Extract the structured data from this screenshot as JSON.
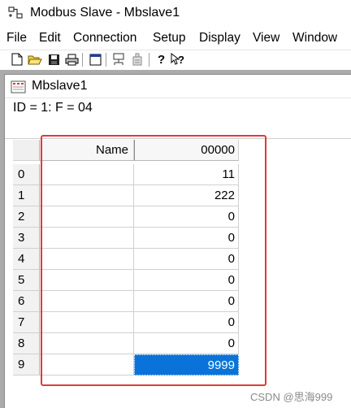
{
  "window": {
    "title": "Modbus Slave - Mbslave1",
    "app_icon": "modbus-app-icon"
  },
  "menu": [
    {
      "label": "File"
    },
    {
      "label": "Edit"
    },
    {
      "label": "Connection"
    },
    {
      "label": "Setup"
    },
    {
      "label": "Display"
    },
    {
      "label": "View"
    },
    {
      "label": "Window"
    }
  ],
  "toolbar": [
    "new-icon",
    "open-icon",
    "save-icon",
    "print-icon",
    "window-icon",
    "connect-icon",
    "disconnect-icon",
    "help-icon",
    "context-help-icon"
  ],
  "child_window": {
    "title": "Mbslave1",
    "id_line": "ID = 1: F = 04",
    "grid": {
      "header": {
        "name": "Name",
        "address": "00000"
      },
      "rows": [
        {
          "index": "0",
          "name": "",
          "value": "11"
        },
        {
          "index": "1",
          "name": "",
          "value": "222"
        },
        {
          "index": "2",
          "name": "",
          "value": "0"
        },
        {
          "index": "3",
          "name": "",
          "value": "0"
        },
        {
          "index": "4",
          "name": "",
          "value": "0"
        },
        {
          "index": "5",
          "name": "",
          "value": "0"
        },
        {
          "index": "6",
          "name": "",
          "value": "0"
        },
        {
          "index": "7",
          "name": "",
          "value": "0"
        },
        {
          "index": "8",
          "name": "",
          "value": "0"
        },
        {
          "index": "9",
          "name": "",
          "value": "9999",
          "selected": true
        }
      ]
    }
  },
  "colors": {
    "selection": "#0a73d9",
    "highlight_box": "#e0393b",
    "mdi_background": "#ababab"
  },
  "watermark": "CSDN @思海999"
}
